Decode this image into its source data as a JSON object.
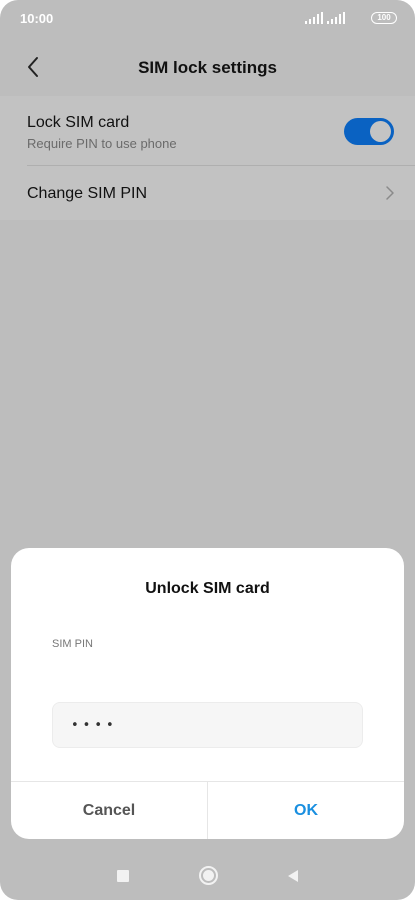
{
  "status_bar": {
    "time": "10:00",
    "battery": "100",
    "icons": [
      "signal-icon",
      "signal-icon",
      "battery-icon"
    ]
  },
  "header": {
    "title": "SIM lock settings",
    "back_icon": "chevron-left-icon"
  },
  "settings": {
    "lock_sim": {
      "title": "Lock SIM card",
      "subtitle": "Require PIN to use phone",
      "enabled": true
    },
    "change_pin": {
      "title": "Change SIM PIN",
      "icon": "chevron-right-icon"
    }
  },
  "dialog": {
    "title": "Unlock SIM card",
    "field_label": "SIM PIN",
    "pin_value": "••••",
    "cancel_label": "Cancel",
    "ok_label": "OK"
  },
  "colors": {
    "accent": "#0a62c2",
    "ok_text": "#1a8fe0",
    "overlay": "#bdbdbd"
  },
  "nav_bar": {
    "icons": [
      "recents-icon",
      "home-icon",
      "back-icon"
    ]
  }
}
